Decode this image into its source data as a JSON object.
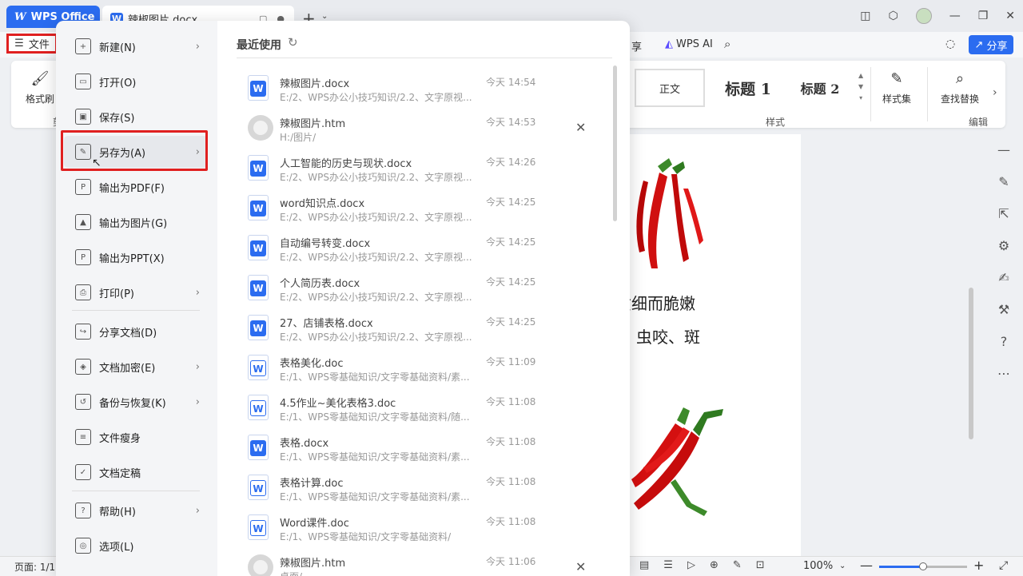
{
  "titlebar": {
    "app_name": "WPS Office",
    "doc_tab": "辣椒图片.docx",
    "new_tab": "+"
  },
  "menurow": {
    "file_label": "文件",
    "share_fragment": "享",
    "ai_label": "WPS AI",
    "share_button": "分享"
  },
  "ribbon": {
    "format_painter": "格式刷",
    "group_label_left": "剪",
    "style_normal": "正文",
    "style_h1": "标题 1",
    "style_h2": "标题 2",
    "style_set": "样式集",
    "find_replace": "查找替换",
    "group_styles": "样式",
    "group_edit": "编辑"
  },
  "document": {
    "line1": "质细而脆嫩",
    "line2": "虫咬、斑"
  },
  "file_menu": {
    "items": [
      {
        "label": "新建(N)",
        "icon": "new-icon",
        "arrow": true
      },
      {
        "label": "打开(O)",
        "icon": "folder-icon",
        "arrow": false
      },
      {
        "label": "保存(S)",
        "icon": "save-icon",
        "arrow": false
      },
      {
        "label": "另存为(A)",
        "icon": "save-as-icon",
        "arrow": true
      },
      {
        "label": "输出为PDF(F)",
        "icon": "pdf-icon",
        "arrow": false
      },
      {
        "label": "输出为图片(G)",
        "icon": "image-icon",
        "arrow": false
      },
      {
        "label": "输出为PPT(X)",
        "icon": "ppt-icon",
        "arrow": false
      },
      {
        "label": "打印(P)",
        "icon": "print-icon",
        "arrow": true
      },
      {
        "label": "分享文档(D)",
        "icon": "share-icon",
        "arrow": false
      },
      {
        "label": "文档加密(E)",
        "icon": "lock-icon",
        "arrow": true
      },
      {
        "label": "备份与恢复(K)",
        "icon": "backup-icon",
        "arrow": true
      },
      {
        "label": "文件瘦身",
        "icon": "slim-icon",
        "arrow": false
      },
      {
        "label": "文档定稿",
        "icon": "finalize-icon",
        "arrow": false
      },
      {
        "label": "帮助(H)",
        "icon": "help-icon",
        "arrow": true
      },
      {
        "label": "选项(L)",
        "icon": "options-icon",
        "arrow": false
      }
    ]
  },
  "recent": {
    "title": "最近使用",
    "files": [
      {
        "name": "辣椒图片.docx",
        "path": "E:/2、WPS办公小技巧知识/2.2、文字原视...",
        "time": "今天 14:54",
        "type": "docx"
      },
      {
        "name": "辣椒图片.htm",
        "path": "H:/图片/",
        "time": "今天 14:53",
        "type": "htm",
        "close": true
      },
      {
        "name": "人工智能的历史与现状.docx",
        "path": "E:/2、WPS办公小技巧知识/2.2、文字原视...",
        "time": "今天 14:26",
        "type": "docx"
      },
      {
        "name": "word知识点.docx",
        "path": "E:/2、WPS办公小技巧知识/2.2、文字原视...",
        "time": "今天 14:25",
        "type": "docx"
      },
      {
        "name": "自动编号转变.docx",
        "path": "E:/2、WPS办公小技巧知识/2.2、文字原视...",
        "time": "今天 14:25",
        "type": "docx"
      },
      {
        "name": "个人简历表.docx",
        "path": "E:/2、WPS办公小技巧知识/2.2、文字原视...",
        "time": "今天 14:25",
        "type": "docx"
      },
      {
        "name": "27、店铺表格.docx",
        "path": "E:/2、WPS办公小技巧知识/2.2、文字原视...",
        "time": "今天 14:25",
        "type": "docx"
      },
      {
        "name": "表格美化.doc",
        "path": "E:/1、WPS零基础知识/文字零基础资料/素...",
        "time": "今天 11:09",
        "type": "doc"
      },
      {
        "name": "4.5作业~美化表格3.doc",
        "path": "E:/1、WPS零基础知识/文字零基础资料/随...",
        "time": "今天 11:08",
        "type": "doc"
      },
      {
        "name": "表格.docx",
        "path": "E:/1、WPS零基础知识/文字零基础资料/素...",
        "time": "今天 11:08",
        "type": "docx"
      },
      {
        "name": "表格计算.doc",
        "path": "E:/1、WPS零基础知识/文字零基础资料/素...",
        "time": "今天 11:08",
        "type": "doc"
      },
      {
        "name": "Word课件.doc",
        "path": "E:/1、WPS零基础知识/文字零基础资料/",
        "time": "今天 11:08",
        "type": "doc"
      },
      {
        "name": "辣椒图片.htm",
        "path": "桌面/",
        "time": "今天 11:06",
        "type": "htm",
        "close": true
      }
    ]
  },
  "statusbar": {
    "page": "页面: 1/1",
    "zoom": "100%",
    "zoom_fraction": 0.5
  },
  "colors": {
    "accent": "#2b6cf0",
    "highlight": "#e02020"
  }
}
